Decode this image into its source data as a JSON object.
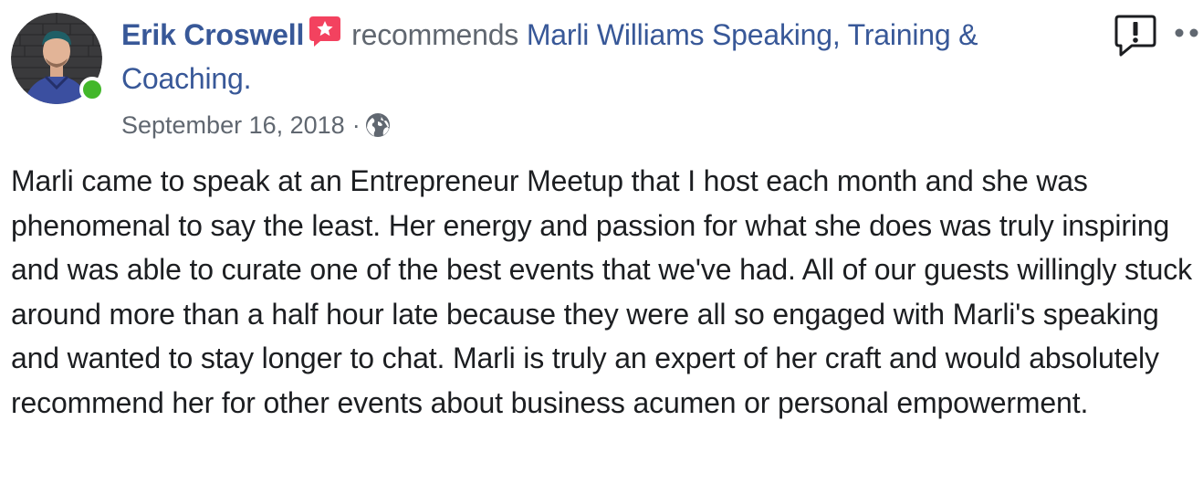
{
  "post": {
    "author_name": "Erik Croswell",
    "verb": "recommends",
    "page_name": "Marli Williams Speaking, Training & Coaching.",
    "date": "September 16, 2018",
    "separator": "·",
    "privacy_icon": "globe-icon",
    "report_icon": "report-flag-icon",
    "more_icon": "more-options-icon",
    "badge_icon": "recommendation-star-badge-icon",
    "body": "Marli came to speak at an Entrepreneur Meetup that I host each month and she was phenomenal to say the least. Her energy and passion for what she does was truly inspiring and was able to curate one of the best events that we've had. All of our guests willingly stuck around more than a half hour late because they were all so engaged with Marli's speaking and wanted to stay longer to chat. Marli is truly an expert of her craft and would absolutely recommend her for other events about business acumen or personal empowerment."
  },
  "colors": {
    "link": "#385898",
    "secondary_text": "#606770",
    "body_text": "#1c1e21",
    "badge": "#f3425f",
    "online": "#42b72a"
  }
}
